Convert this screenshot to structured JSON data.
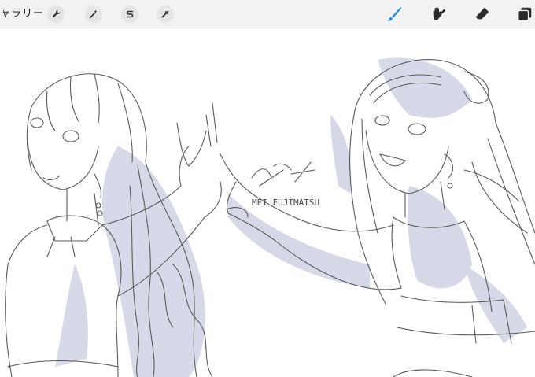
{
  "toolbar": {
    "gallery_label": "ャラリー",
    "left_tools": [
      {
        "icon": "wrench-icon"
      },
      {
        "icon": "magic-wand-icon"
      },
      {
        "icon": "selection-s-icon"
      },
      {
        "icon": "arrow-cursor-icon"
      }
    ],
    "right_tools": [
      {
        "icon": "brush-icon",
        "active": true
      },
      {
        "icon": "smudge-icon"
      },
      {
        "icon": "eraser-icon"
      },
      {
        "icon": "layers-icon"
      }
    ],
    "accent_color": "#1e8fe8"
  },
  "canvas": {
    "background": "#ffffff",
    "shading_color": "#c9cbe0",
    "line_color": "#5a5a5a",
    "signature": "MEI FUJIMATSU"
  }
}
